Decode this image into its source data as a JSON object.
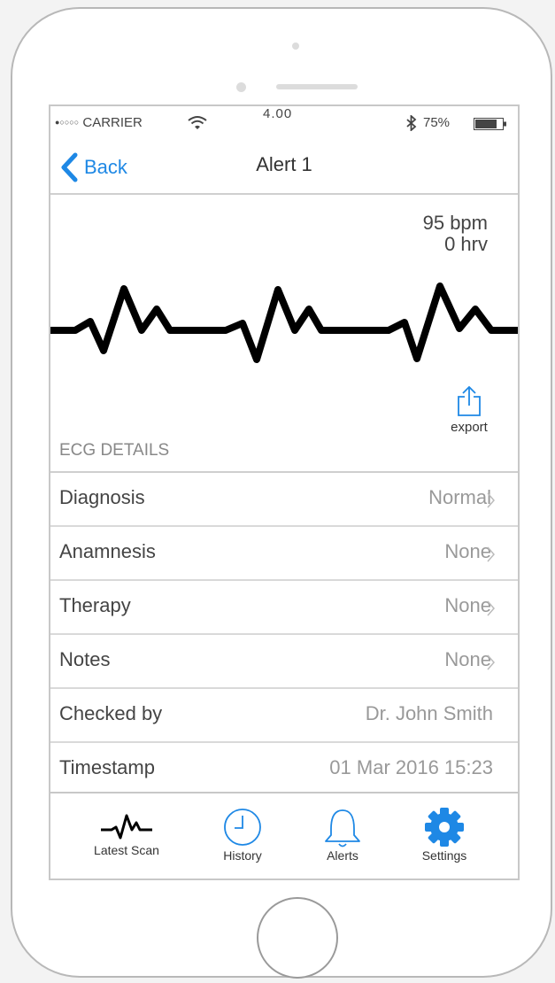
{
  "status_bar": {
    "carrier_dots": "●○○○○",
    "carrier": "CARRIER",
    "time": "4.00",
    "battery": "75%"
  },
  "nav": {
    "back_label": "Back",
    "title": "Alert 1"
  },
  "vitals": {
    "bpm": "95 bpm",
    "hrv": "0  hrv"
  },
  "export_label": "export",
  "section_label": "ECG DETAILS",
  "details": [
    {
      "label": "Diagnosis",
      "value": "Normal"
    },
    {
      "label": "Anamnesis",
      "value": "None"
    },
    {
      "label": "Therapy",
      "value": "None"
    },
    {
      "label": "Notes",
      "value": "None"
    },
    {
      "label": "Checked by",
      "value": "Dr. John Smith"
    },
    {
      "label": "Timestamp",
      "value": "01 Mar 2016 15:23"
    }
  ],
  "tabs": [
    {
      "label": "Latest Scan",
      "icon": "heartbeat-icon"
    },
    {
      "label": "History",
      "icon": "clock-icon"
    },
    {
      "label": "Alerts",
      "icon": "bell-icon"
    },
    {
      "label": "Settings",
      "icon": "gear-icon"
    }
  ],
  "colors": {
    "accent": "#1e88e5",
    "text": "#444444",
    "muted": "#999999"
  }
}
